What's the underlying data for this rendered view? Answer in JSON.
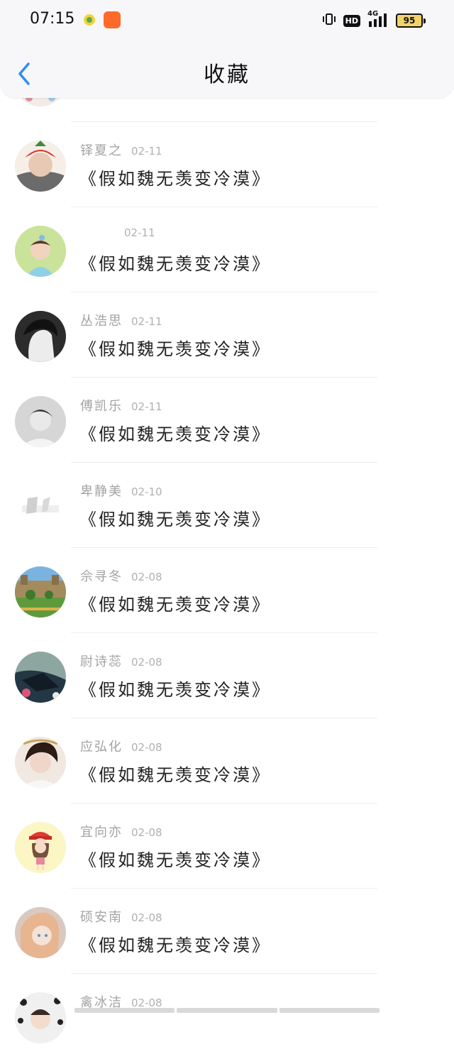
{
  "status_bar": {
    "time": "07:15",
    "hd": "HD",
    "signal": "4G",
    "battery": "95"
  },
  "header": {
    "title": "收藏"
  },
  "items": [
    {
      "user": "",
      "date": "",
      "title": ""
    },
    {
      "user": "铎夏之",
      "date": "02-11",
      "title": "《假如魏无羡变冷漠》"
    },
    {
      "user": "",
      "date": "02-11",
      "title": "《假如魏无羡变冷漠》"
    },
    {
      "user": "丛浩思",
      "date": "02-11",
      "title": "《假如魏无羡变冷漠》"
    },
    {
      "user": "傅凯乐",
      "date": "02-11",
      "title": "《假如魏无羡变冷漠》"
    },
    {
      "user": "卑静美",
      "date": "02-10",
      "title": "《假如魏无羡变冷漠》"
    },
    {
      "user": "佘寻冬",
      "date": "02-08",
      "title": "《假如魏无羡变冷漠》"
    },
    {
      "user": "尉诗蕊",
      "date": "02-08",
      "title": "《假如魏无羡变冷漠》"
    },
    {
      "user": "应弘化",
      "date": "02-08",
      "title": "《假如魏无羡变冷漠》"
    },
    {
      "user": "宜向亦",
      "date": "02-08",
      "title": "《假如魏无羡变冷漠》"
    },
    {
      "user": "硕安南",
      "date": "02-08",
      "title": "《假如魏无羡变冷漠》"
    },
    {
      "user": "禽冰洁",
      "date": "02-08",
      "title": ""
    }
  ],
  "colors": {
    "accent": "#2f8df2",
    "username": "#a3a3a3",
    "date": "#b0b0b0",
    "title": "#222222"
  }
}
